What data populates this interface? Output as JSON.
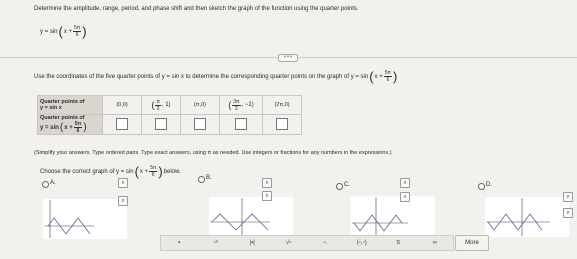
{
  "question": {
    "instruction": "Determine the amplitude, range, period, and phase shift and then sketch the graph of the function using the quarter points.",
    "func_prefix": "y = sin",
    "func_x_plus": "x +",
    "func_num": "5π",
    "func_den": "6"
  },
  "more_indicator": "• • •",
  "step": {
    "text_before": "Use the coordinates of the five quarter points of y = sin x to determine the corresponding quarter points on the graph of y = sin",
    "x_plus": "x +",
    "num": "5π",
    "den": "6"
  },
  "table": {
    "row1_label_line1": "Quarter points of",
    "row1_label_line2": "y = sin x",
    "points": [
      {
        "label": "(0,0)"
      },
      {
        "open": "(",
        "num": "π",
        "den": "2",
        "rest": ", 1)"
      },
      {
        "label": "(π,0)"
      },
      {
        "open": "(",
        "num": "3π",
        "den": "2",
        "rest": ", −1)"
      },
      {
        "label": "(2π,0)"
      }
    ],
    "row2_label_line1": "Quarter points of",
    "row2_label_prefix": "y = sin",
    "row2_x_plus": "x +",
    "row2_num": "5π",
    "row2_den": "6"
  },
  "note": "(Simplify your answers. Type ordered pairs. Type exact answers, using π as needed. Use integers or fractions for any numbers in the expressions.)",
  "choose": {
    "text": "Choose the correct graph of y = sin",
    "x_plus": "x +",
    "num": "5π",
    "den": "6",
    "after": "below."
  },
  "options": [
    {
      "letter": "A."
    },
    {
      "letter": "B."
    },
    {
      "letter": "C."
    },
    {
      "letter": "D."
    }
  ],
  "toolbar": {
    "buttons": [
      "▪",
      "▫ⁿ",
      "|▪|",
      "√▫",
      "▫.",
      "(▫,▫)",
      "π",
      "∞"
    ],
    "more": "More"
  }
}
